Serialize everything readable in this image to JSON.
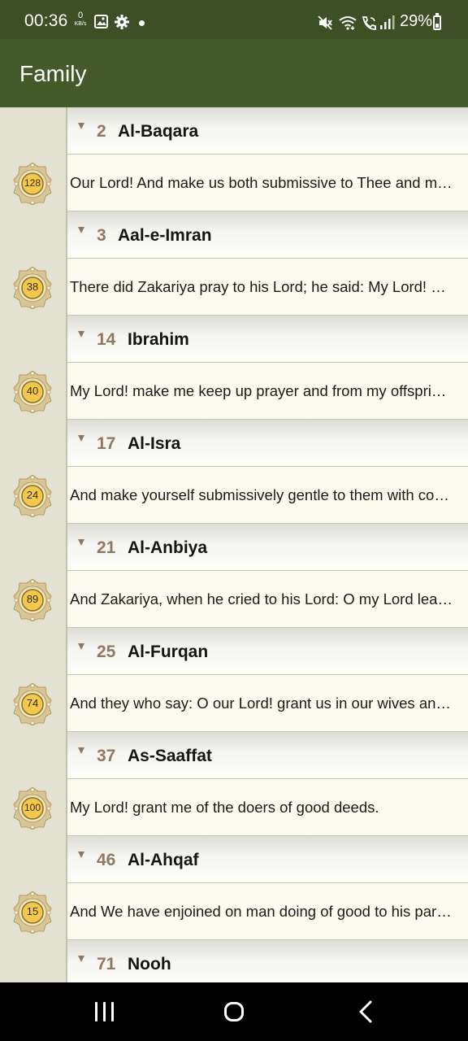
{
  "status_bar": {
    "time": "00:36",
    "net_speed_value": "0",
    "net_speed_unit": "KB/s",
    "battery": "29%"
  },
  "app_bar": {
    "title": "Family"
  },
  "entries": [
    {
      "surah_num": "2",
      "surah_name": "Al-Baqara",
      "ayah": "128",
      "text": "Our Lord! And make us both submissive to Thee and make of our offspring a nation submissive to Thee"
    },
    {
      "surah_num": "3",
      "surah_name": "Aal-e-Imran",
      "ayah": "38",
      "text": "There did Zakariya pray to his Lord; he said: My Lord! grant me from Thee good offspring"
    },
    {
      "surah_num": "14",
      "surah_name": "Ibrahim",
      "ayah": "40",
      "text": "My Lord! make me keep up prayer and from my offspring (too), O our Lord, and accept a prayer"
    },
    {
      "surah_num": "17",
      "surah_name": "Al-Isra",
      "ayah": "24",
      "text": "And make yourself submissively gentle to them with compassion, and say: O my Lord!"
    },
    {
      "surah_num": "21",
      "surah_name": "Al-Anbiya",
      "ayah": "89",
      "text": "And Zakariya, when he cried to his Lord: O my Lord leave me not alone"
    },
    {
      "surah_num": "25",
      "surah_name": "Al-Furqan",
      "ayah": "74",
      "text": "And they who say: O our Lord! grant us in our wives and our offspring the joy of our eyes"
    },
    {
      "surah_num": "37",
      "surah_name": "As-Saaffat",
      "ayah": "100",
      "text": "My Lord! grant me of the doers of good deeds."
    },
    {
      "surah_num": "46",
      "surah_name": "Al-Ahqaf",
      "ayah": "15",
      "text": "And We have enjoined on man doing of good to his parents"
    },
    {
      "surah_num": "71",
      "surah_name": "Nooh",
      "ayah": "",
      "text": ""
    }
  ],
  "colors": {
    "status_bar": "#3d5025",
    "app_bar": "#455a2a",
    "surah_number": "#8c7a63",
    "badge_fill": "#f2c94c",
    "content_bg": "#fdfbef",
    "gutter_bg": "#e3e1d2"
  },
  "icons": {
    "status_left": [
      "gallery-icon",
      "settings-icon",
      "dot-icon"
    ],
    "status_right": [
      "mute-icon",
      "wifi-icon",
      "wifi-calling-icon",
      "signal-icon",
      "battery-icon"
    ],
    "nav": [
      "recents-icon",
      "home-icon",
      "back-icon"
    ]
  }
}
